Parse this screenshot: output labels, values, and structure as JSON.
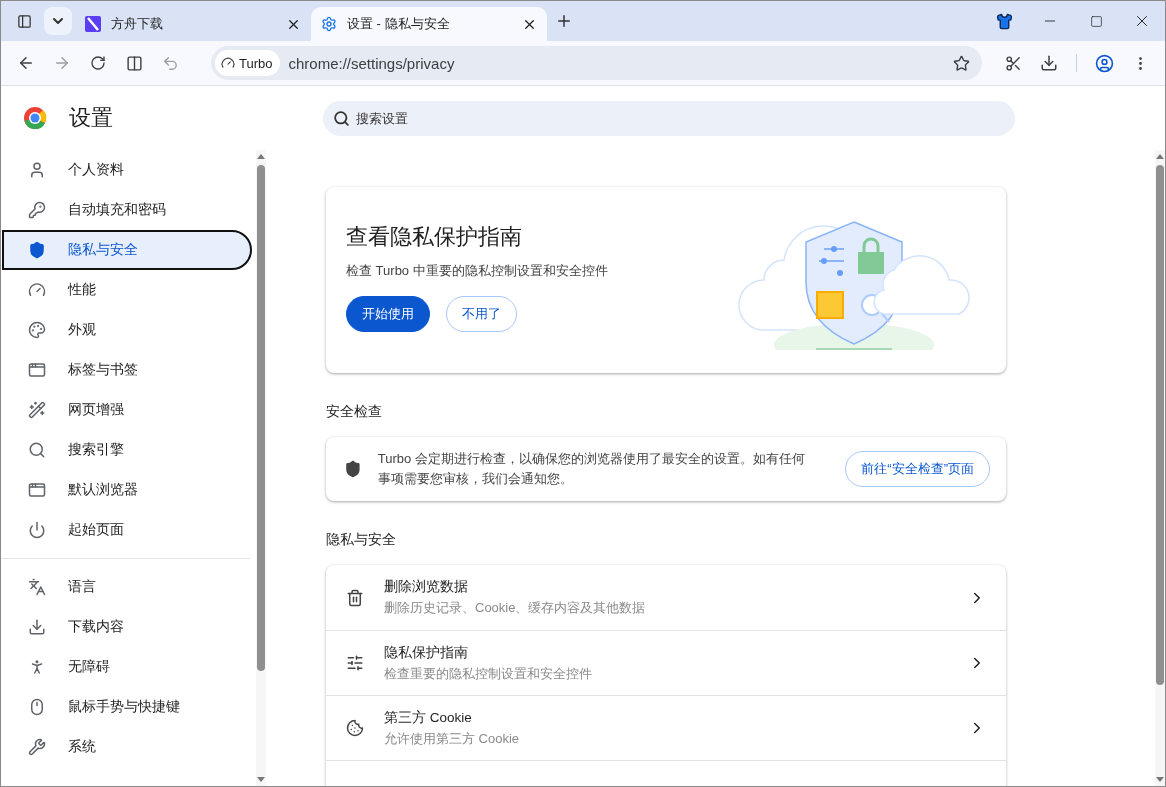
{
  "tabs": [
    {
      "title": "方舟下载",
      "selected": false
    },
    {
      "title": "设置 - 隐私与安全",
      "selected": true
    }
  ],
  "toolbar": {
    "badge": "Turbo",
    "url": "chrome://settings/privacy"
  },
  "header": {
    "title": "设置"
  },
  "search": {
    "placeholder": "搜索设置"
  },
  "sidebar": {
    "sections": [
      {
        "items": [
          {
            "label": "个人资料",
            "selected": false
          },
          {
            "label": "自动填充和密码",
            "selected": false
          },
          {
            "label": "隐私与安全",
            "selected": true
          },
          {
            "label": "性能",
            "selected": false
          },
          {
            "label": "外观",
            "selected": false
          },
          {
            "label": "标签与书签",
            "selected": false
          },
          {
            "label": "网页增强",
            "selected": false
          },
          {
            "label": "搜索引擎",
            "selected": false
          },
          {
            "label": "默认浏览器",
            "selected": false
          },
          {
            "label": "起始页面",
            "selected": false
          }
        ]
      },
      {
        "items": [
          {
            "label": "语言",
            "selected": false
          },
          {
            "label": "下载内容",
            "selected": false
          },
          {
            "label": "无障碍",
            "selected": false
          },
          {
            "label": "鼠标手势与快捷键",
            "selected": false
          },
          {
            "label": "系统",
            "selected": false
          }
        ]
      }
    ]
  },
  "guide_card": {
    "title": "查看隐私保护指南",
    "description": "检查 Turbo 中重要的隐私控制设置和安全控件",
    "buttons": [
      {
        "label": "开始使用",
        "kind": "primary"
      },
      {
        "label": "不用了",
        "kind": "secondary"
      }
    ]
  },
  "safety_check": {
    "heading": "安全检查",
    "text": "Turbo 会定期进行检查，以确保您的浏览器使用了最安全的设置。如有任何事项需要您审核，我们会通知您。",
    "button": "前往“安全检查”页面"
  },
  "privacy": {
    "heading": "隐私与安全",
    "rows": [
      {
        "title": "删除浏览数据",
        "subtitle": "删除历史记录、Cookie、缓存内容及其他数据"
      },
      {
        "title": "隐私保护指南",
        "subtitle": "检查重要的隐私控制设置和安全控件"
      },
      {
        "title": "第三方 Cookie",
        "subtitle": "允许使用第三方 Cookie"
      }
    ]
  }
}
